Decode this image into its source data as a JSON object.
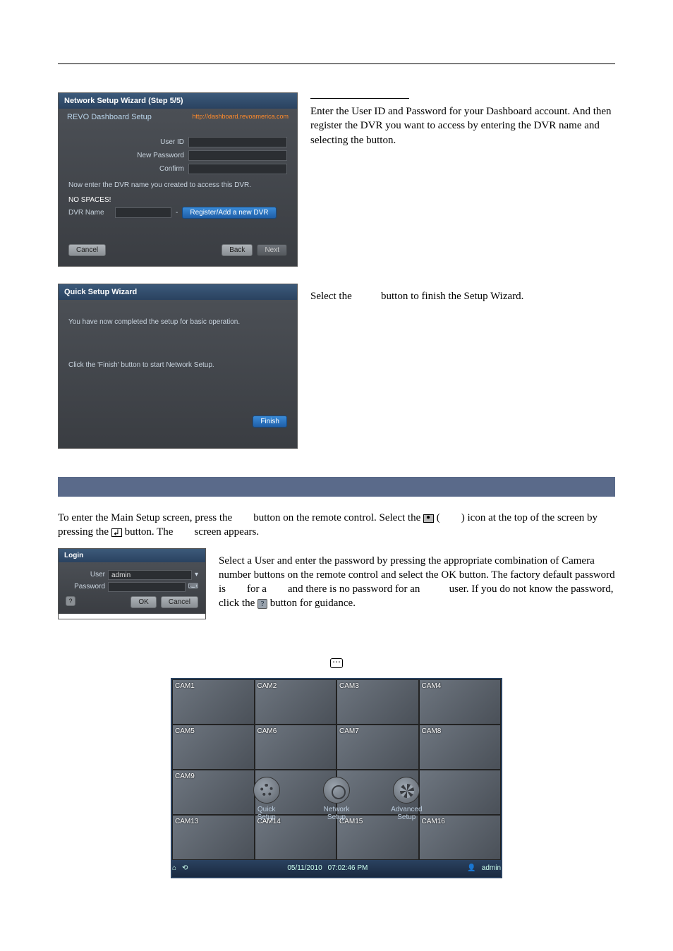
{
  "page_header_rule": true,
  "wizard_step5": {
    "title": "Network Setup Wizard (Step 5/5)",
    "setup_label": "REVO Dashboard Setup",
    "link": "http://dashboard.revoamerica.com",
    "fields": {
      "user_id": "User ID",
      "new_password": "New Password",
      "confirm": "Confirm"
    },
    "note_line1": "Now enter the DVR name you created to access this DVR.",
    "note_line2": "NO SPACES!",
    "dvr_name_label": "DVR Name",
    "register_btn": "Register/Add a new DVR",
    "cancel_btn": "Cancel",
    "back_btn": "Back",
    "next_btn": "Next"
  },
  "wizard_step5_text": "Enter the User ID and Password for your Dashboard account.  And then register the DVR you want to access by entering the DVR name and selecting the                                         button.",
  "wizard_finish": {
    "title": "Quick Setup Wizard",
    "line1": "You have now completed the setup for basic operation.",
    "line2": "Click the 'Finish' button to start Network Setup.",
    "finish_btn": "Finish"
  },
  "wizard_finish_text_a": "Select the",
  "wizard_finish_text_b": "button to finish the Setup Wizard.",
  "main_setup": {
    "para1_a": "To enter the Main Setup screen, press the",
    "para1_b": "button on the remote control.  Select the",
    "para1_c": "(",
    "para1_d": ") icon at the top of the screen by pressing the",
    "para1_e": "button.  The",
    "para1_f": "screen appears."
  },
  "login": {
    "title": "Login",
    "user_label": "User",
    "user_value": "admin",
    "password_label": "Password",
    "ok_btn": "OK",
    "cancel_btn": "Cancel"
  },
  "login_para_a": "Select a User and enter the password by pressing the appropriate combination of Camera number buttons on the remote control and select the OK button.  The factory default password is",
  "login_para_b": "for a",
  "login_para_c": "and there is no password for an",
  "login_para_d": "user. If you do not know the password, click the",
  "login_para_e": "button for guidance.",
  "dvr": {
    "cams": [
      "CAM1",
      "CAM2",
      "CAM3",
      "CAM4",
      "CAM5",
      "CAM6",
      "CAM7",
      "CAM8",
      "CAM9",
      "",
      "",
      "",
      "CAM13",
      "CAM14",
      "CAM15",
      "CAM16"
    ],
    "overlay": {
      "quick": "Quick\nSetup",
      "network": "Network\nSetup",
      "advanced": "Advanced\nSetup"
    },
    "status_date": "05/11/2010",
    "status_time": "07:02:46 PM",
    "status_user": "admin"
  }
}
